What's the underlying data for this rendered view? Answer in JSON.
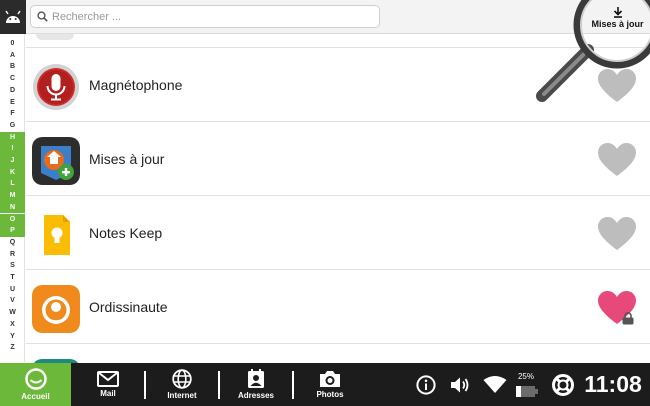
{
  "search": {
    "placeholder": "Rechercher ..."
  },
  "header": {
    "updates_label": "Mises à jour"
  },
  "alphabet": {
    "letters": [
      "0",
      "A",
      "B",
      "C",
      "D",
      "E",
      "F",
      "G",
      "H",
      "I",
      "J",
      "K",
      "L",
      "M",
      "N",
      "O",
      "P",
      "Q",
      "R",
      "S",
      "T",
      "U",
      "V",
      "W",
      "X",
      "Y",
      "Z"
    ],
    "active": [
      "H",
      "I",
      "J",
      "K",
      "L",
      "M",
      "N",
      "O",
      "P"
    ]
  },
  "apps": [
    {
      "name": "Magnétophone",
      "icon": "microphone-icon",
      "favorite": false
    },
    {
      "name": "Mises à jour",
      "icon": "updates-app-icon",
      "favorite": false
    },
    {
      "name": "Notes Keep",
      "icon": "keep-notes-icon",
      "favorite": false
    },
    {
      "name": "Ordissinaute",
      "icon": "ordissinaute-icon",
      "favorite": true,
      "locked": true
    }
  ],
  "colors": {
    "accent_green": "#6cb83a",
    "heart_gray": "#bdbdbd",
    "heart_pink": "#e8497b",
    "bar_dark": "#1c1c1c"
  },
  "nav": {
    "home": "Accueil",
    "mail": "Mail",
    "internet": "Internet",
    "contacts": "Adresses",
    "photos": "Photos"
  },
  "status": {
    "battery": "25%",
    "time": "11:08"
  }
}
